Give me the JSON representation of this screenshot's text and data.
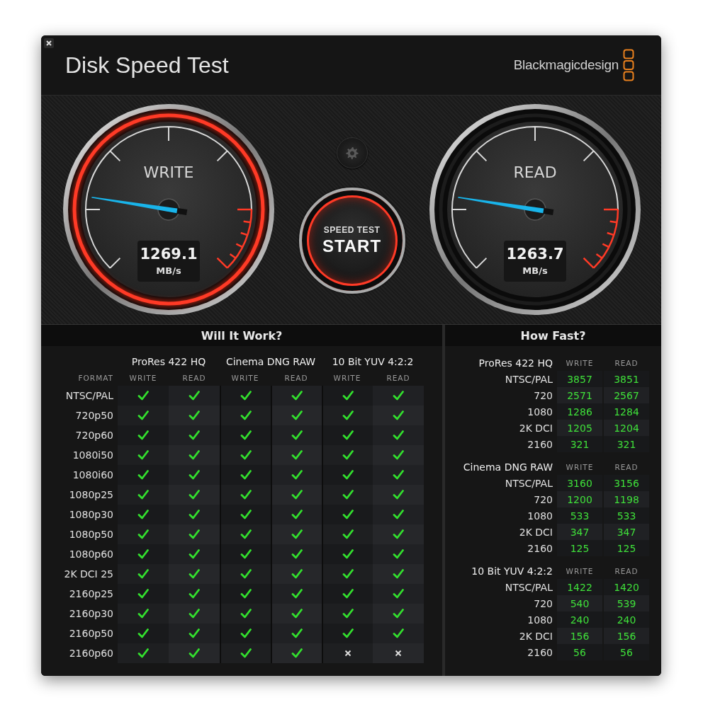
{
  "window": {
    "title": "Disk Speed Test",
    "brand": "Blackmagicdesign"
  },
  "gauges": [
    {
      "label": "WRITE",
      "value": "1269.1",
      "unit": "MB/s",
      "level": 0.2,
      "active": true
    },
    {
      "label": "READ",
      "value": "1263.7",
      "unit": "MB/s",
      "level": 0.2,
      "active": false
    }
  ],
  "start_button": {
    "caption": "SPEED TEST",
    "label": "START"
  },
  "will_it_work": {
    "title": "Will It Work?",
    "format_header": "FORMAT",
    "codecs": [
      {
        "name": "ProRes 422 HQ",
        "columns": [
          "WRITE",
          "READ"
        ]
      },
      {
        "name": "Cinema DNG RAW",
        "columns": [
          "WRITE",
          "READ"
        ]
      },
      {
        "name": "10 Bit YUV 4:2:2",
        "columns": [
          "WRITE",
          "READ"
        ]
      }
    ],
    "rows": [
      {
        "format": "NTSC/PAL",
        "results": [
          true,
          true,
          true,
          true,
          true,
          true
        ]
      },
      {
        "format": "720p50",
        "results": [
          true,
          true,
          true,
          true,
          true,
          true
        ]
      },
      {
        "format": "720p60",
        "results": [
          true,
          true,
          true,
          true,
          true,
          true
        ]
      },
      {
        "format": "1080i50",
        "results": [
          true,
          true,
          true,
          true,
          true,
          true
        ]
      },
      {
        "format": "1080i60",
        "results": [
          true,
          true,
          true,
          true,
          true,
          true
        ]
      },
      {
        "format": "1080p25",
        "results": [
          true,
          true,
          true,
          true,
          true,
          true
        ]
      },
      {
        "format": "1080p30",
        "results": [
          true,
          true,
          true,
          true,
          true,
          true
        ]
      },
      {
        "format": "1080p50",
        "results": [
          true,
          true,
          true,
          true,
          true,
          true
        ]
      },
      {
        "format": "1080p60",
        "results": [
          true,
          true,
          true,
          true,
          true,
          true
        ]
      },
      {
        "format": "2K DCI 25",
        "results": [
          true,
          true,
          true,
          true,
          true,
          true
        ]
      },
      {
        "format": "2160p25",
        "results": [
          true,
          true,
          true,
          true,
          true,
          true
        ]
      },
      {
        "format": "2160p30",
        "results": [
          true,
          true,
          true,
          true,
          true,
          true
        ]
      },
      {
        "format": "2160p50",
        "results": [
          true,
          true,
          true,
          true,
          true,
          true
        ]
      },
      {
        "format": "2160p60",
        "results": [
          true,
          true,
          true,
          true,
          false,
          false
        ]
      }
    ]
  },
  "how_fast": {
    "title": "How Fast?",
    "groups": [
      {
        "name": "ProRes 422 HQ",
        "write_header": "WRITE",
        "read_header": "READ",
        "rows": [
          {
            "format": "NTSC/PAL",
            "write": "3857",
            "read": "3851"
          },
          {
            "format": "720",
            "write": "2571",
            "read": "2567"
          },
          {
            "format": "1080",
            "write": "1286",
            "read": "1284"
          },
          {
            "format": "2K DCI",
            "write": "1205",
            "read": "1204"
          },
          {
            "format": "2160",
            "write": "321",
            "read": "321"
          }
        ]
      },
      {
        "name": "Cinema DNG RAW",
        "write_header": "WRITE",
        "read_header": "READ",
        "rows": [
          {
            "format": "NTSC/PAL",
            "write": "3160",
            "read": "3156"
          },
          {
            "format": "720",
            "write": "1200",
            "read": "1198"
          },
          {
            "format": "1080",
            "write": "533",
            "read": "533"
          },
          {
            "format": "2K DCI",
            "write": "347",
            "read": "347"
          },
          {
            "format": "2160",
            "write": "125",
            "read": "125"
          }
        ]
      },
      {
        "name": "10 Bit YUV 4:2:2",
        "write_header": "WRITE",
        "read_header": "READ",
        "rows": [
          {
            "format": "NTSC/PAL",
            "write": "1422",
            "read": "1420"
          },
          {
            "format": "720",
            "write": "540",
            "read": "539"
          },
          {
            "format": "1080",
            "write": "240",
            "read": "240"
          },
          {
            "format": "2K DCI",
            "write": "156",
            "read": "156"
          },
          {
            "format": "2160",
            "write": "56",
            "read": "56"
          }
        ]
      }
    ]
  }
}
